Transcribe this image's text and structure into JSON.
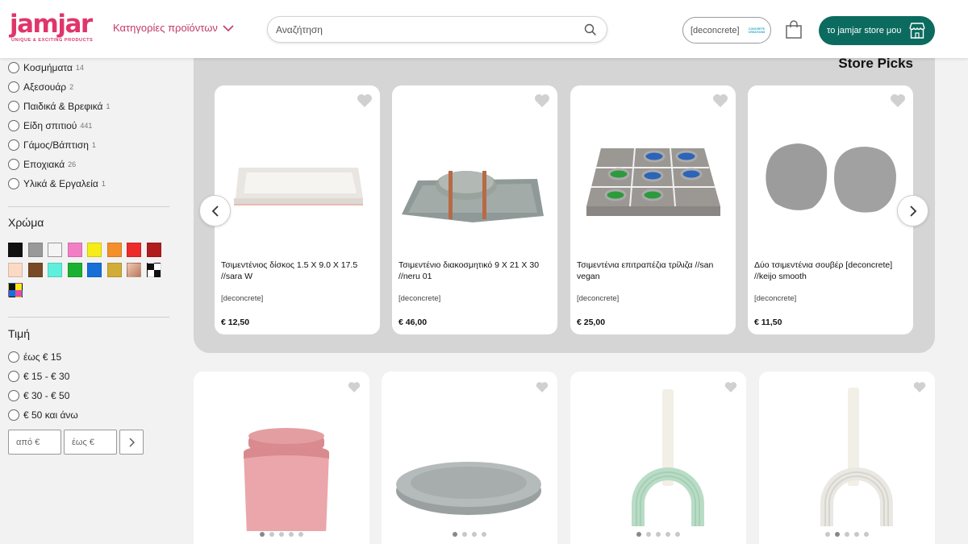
{
  "header": {
    "logo_text": "jamjar",
    "logo_tagline": "UNIQUE & EXCITING PRODUCTS",
    "categories_menu": "Κατηγορίες προϊόντων",
    "search_placeholder": "Αναζήτηση",
    "store_chip": "[deconcrete]",
    "store_chip_logo": "CONCRETE CREATIONS",
    "store_button": "το jamjar store μου"
  },
  "sidebar": {
    "categories": [
      {
        "label": "Κοσμήματα",
        "count": "14"
      },
      {
        "label": "Αξεσουάρ",
        "count": "2"
      },
      {
        "label": "Παιδικά & Βρεφικά",
        "count": "1"
      },
      {
        "label": "Είδη σπιτιού",
        "count": "441"
      },
      {
        "label": "Γάμος/Βάπτιση",
        "count": "1"
      },
      {
        "label": "Εποχιακά",
        "count": "26"
      },
      {
        "label": "Υλικά & Εργαλεία",
        "count": "1"
      }
    ],
    "color_title": "Χρώμα",
    "colors": [
      "#111111",
      "#999999",
      "#f4f4f4",
      "#f27fc6",
      "#f6ec17",
      "#f4902a",
      "#ee2b2b",
      "#b01d1d",
      "#fbd9c4",
      "#7a4a26",
      "#5ef0dc",
      "#1bb130",
      "#1670d9",
      "#d1ad37",
      "gradient",
      "checker",
      "cmyk"
    ],
    "price_title": "Τιμή",
    "price_ranges": [
      "έως € 15",
      "€ 15 - € 30",
      "€ 30 - € 50",
      "€ 50 και άνω"
    ],
    "price_from_placeholder": "από €",
    "price_to_placeholder": "έως €"
  },
  "store_picks": {
    "title": "Store Picks",
    "items": [
      {
        "name": "Τσιμεντένιος δίσκος 1.5 X 9.0 X 17.5 //sara W",
        "store": "[deconcrete]",
        "price": "€ 12,50"
      },
      {
        "name": "Τσιμεντένιο διακοσμητικό 9 X 21 X 30 //neru 01",
        "store": "[deconcrete]",
        "price": "€ 46,00"
      },
      {
        "name": "Τσιμεντένια επιτραπέζια τρίλιζα //san vegan",
        "store": "[deconcrete]",
        "price": "€ 25,00"
      },
      {
        "name": "Δύο τσιμεντένια σουβέρ [deconcrete] //keijo smooth",
        "store": "[deconcrete]",
        "price": "€ 11,50"
      }
    ]
  },
  "grid_products": [
    {
      "image": "pink-concrete-jar",
      "active_dot": 0
    },
    {
      "image": "grey-round-tray",
      "active_dot": 0
    },
    {
      "image": "mint-rainbow-candle-holder",
      "active_dot": 0
    },
    {
      "image": "white-rainbow-candle-holder",
      "active_dot": 1
    }
  ]
}
